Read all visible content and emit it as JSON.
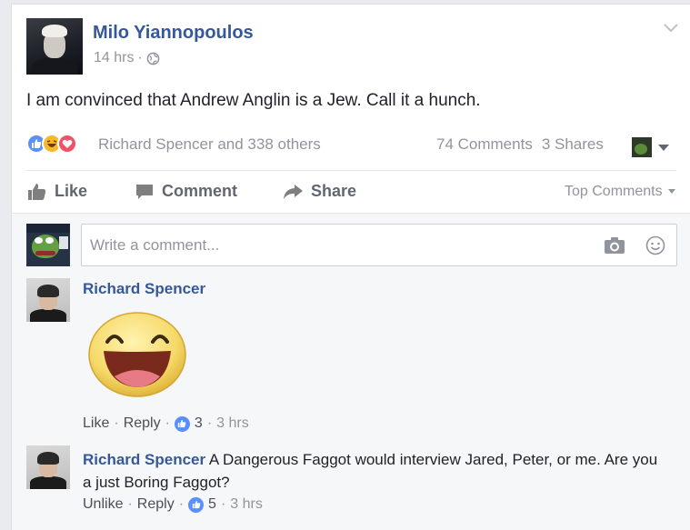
{
  "post": {
    "author": "Milo Yiannopoulos",
    "time": "14 hrs",
    "separator": "·",
    "text": "I am convinced that Andrew Anglin is a Jew. Call it a hunch.",
    "reactors": "Richard Spencer and 338 others",
    "comments_count": "74 Comments",
    "shares_count": "3 Shares"
  },
  "actions": {
    "like": "Like",
    "comment": "Comment",
    "share": "Share",
    "sort": "Top Comments"
  },
  "composer": {
    "placeholder": "Write a comment..."
  },
  "comments": [
    {
      "author": "Richard Spencer",
      "text": "",
      "action1": "Like",
      "action2": "Reply",
      "likes": "3",
      "time": "3 hrs"
    },
    {
      "author": "Richard Spencer",
      "text": "A Dangerous Faggot would interview Jared, Peter, or me. Are you a just Boring Faggot?",
      "action1": "Unlike",
      "action2": "Reply",
      "likes": "5",
      "time": "3 hrs"
    }
  ],
  "colors": {
    "link_blue": "#365899",
    "meta_gray": "#90949c",
    "like_blue": "#5890ff",
    "haha_yellow": "#f7b928",
    "love_red": "#f25268"
  },
  "icons": [
    "globe-icon",
    "like-reaction-icon",
    "haha-reaction-icon",
    "love-reaction-icon",
    "thumbs-up-icon",
    "comment-icon",
    "share-arrow-icon",
    "camera-icon",
    "smiley-icon",
    "chevron-down-icon",
    "laughing-emoji-sticker"
  ]
}
